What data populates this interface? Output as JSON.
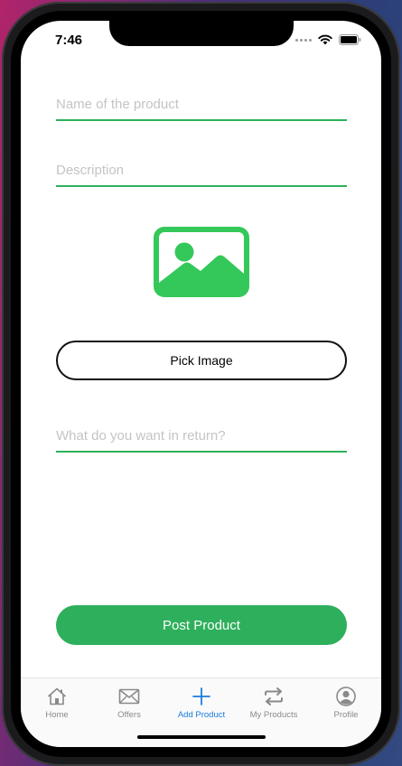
{
  "status_bar": {
    "time": "7:46"
  },
  "form": {
    "name_placeholder": "Name of the product",
    "description_placeholder": "Description",
    "return_placeholder": "What do you want in return?",
    "pick_image_label": "Pick Image",
    "post_label": "Post Product"
  },
  "icons": {
    "image_placeholder": "image-icon",
    "home": "home-icon",
    "offers": "envelope-icon",
    "add": "plus-icon",
    "my_products": "swap-icon",
    "profile": "user-circle-icon"
  },
  "colors": {
    "accent_green": "#2eaf5c",
    "image_icon_green": "#34c85a",
    "active_tab_blue": "#1a7be0"
  },
  "tabbar": {
    "items": [
      {
        "label": "Home",
        "active": false
      },
      {
        "label": "Offers",
        "active": false
      },
      {
        "label": "Add Product",
        "active": true
      },
      {
        "label": "My Products",
        "active": false
      },
      {
        "label": "Profile",
        "active": false
      }
    ]
  }
}
